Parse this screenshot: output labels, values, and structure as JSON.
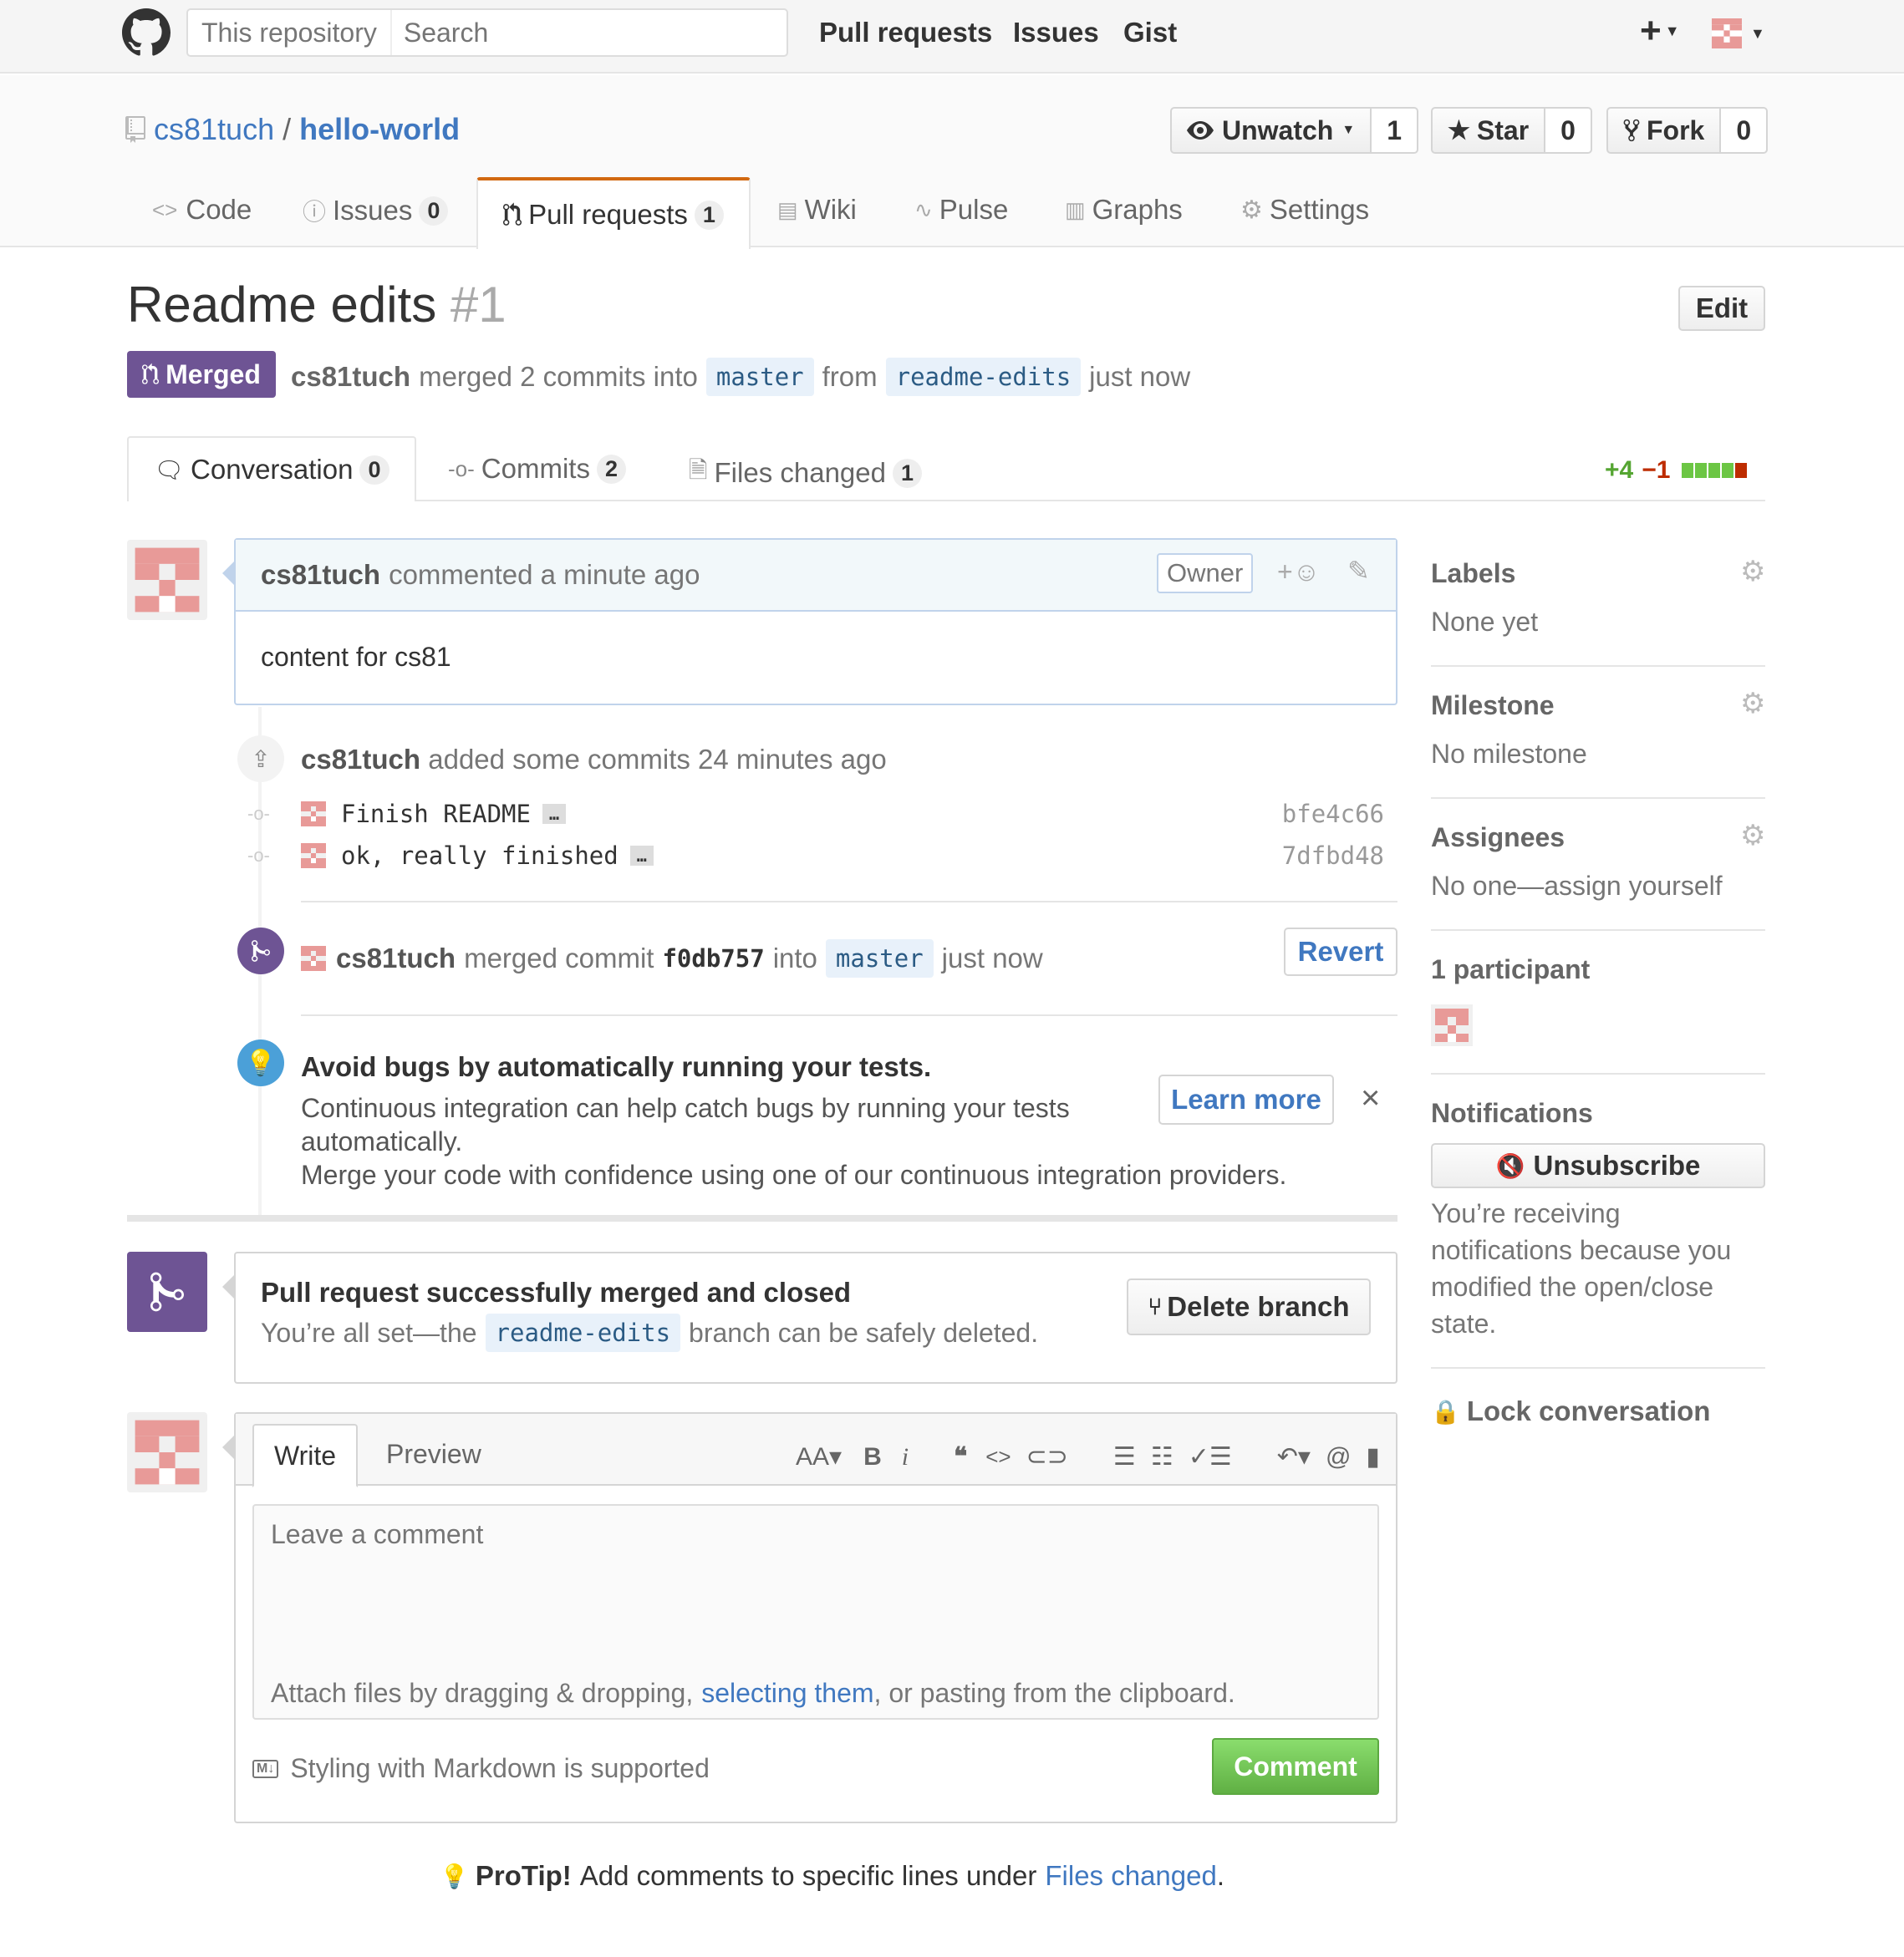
{
  "header": {
    "scope_label": "This repository",
    "search_placeholder": "Search",
    "nav": [
      "Pull requests",
      "Issues",
      "Gist"
    ],
    "plus_label": "+"
  },
  "repo": {
    "owner": "cs81tuch",
    "separator": "/",
    "name": "hello-world",
    "watch_label": "Unwatch",
    "watch_count": "1",
    "star_label": "Star",
    "star_count": "0",
    "fork_label": "Fork",
    "fork_count": "0"
  },
  "repo_tabs": [
    {
      "label": "Code",
      "count": "",
      "icon": "code-icon"
    },
    {
      "label": "Issues",
      "count": "0",
      "icon": "issue-icon"
    },
    {
      "label": "Pull requests",
      "count": "1",
      "icon": "pull-request-icon",
      "selected": true
    },
    {
      "label": "Wiki",
      "count": "",
      "icon": "book-icon"
    },
    {
      "label": "Pulse",
      "count": "",
      "icon": "pulse-icon"
    },
    {
      "label": "Graphs",
      "count": "",
      "icon": "graph-icon"
    },
    {
      "label": "Settings",
      "count": "",
      "icon": "gear-icon"
    }
  ],
  "pr": {
    "title": "Readme edits",
    "number": "#1",
    "edit_label": "Edit",
    "state": "Merged",
    "author": "cs81tuch",
    "merged_text": "merged 2 commits into",
    "base_branch": "master",
    "from_text": "from",
    "head_branch": "readme-edits",
    "time": "just now"
  },
  "pr_tabs": [
    {
      "label": "Conversation",
      "count": "0"
    },
    {
      "label": "Commits",
      "count": "2"
    },
    {
      "label": "Files changed",
      "count": "1"
    }
  ],
  "diffstat": {
    "additions": "+4",
    "deletions": "−1"
  },
  "comment": {
    "author": "cs81tuch",
    "meta": "commented a minute ago",
    "role": "Owner",
    "body": "content for cs81"
  },
  "commits_event": {
    "author": "cs81tuch",
    "text": "added some commits 24 minutes ago",
    "commits": [
      {
        "message": "Finish README",
        "sha": "bfe4c66"
      },
      {
        "message": "ok, really finished",
        "sha": "7dfbd48"
      }
    ],
    "ellipsis": "…"
  },
  "merge_event": {
    "author": "cs81tuch",
    "text": "merged commit",
    "sha": "f0db757",
    "into": "into",
    "branch": "master",
    "time": "just now",
    "revert_label": "Revert"
  },
  "ci_tip": {
    "title": "Avoid bugs by automatically running your tests.",
    "line1": "Continuous integration can help catch bugs by running your tests",
    "line2": "automatically.",
    "line3": "Merge your code with confidence using one of our continuous integration providers.",
    "learn_more": "Learn more"
  },
  "merged_box": {
    "title": "Pull request successfully merged and closed",
    "text_before": "You’re all set—the",
    "branch": "readme-edits",
    "text_after": "branch can be safely deleted.",
    "delete_label": "Delete branch"
  },
  "editor": {
    "write_tab": "Write",
    "preview_tab": "Preview",
    "placeholder": "Leave a comment",
    "attach_before": "Attach files by dragging & dropping,",
    "attach_link": "selecting them",
    "attach_after": ", or pasting from the clipboard.",
    "markdown_note": "Styling with Markdown is supported",
    "comment_label": "Comment",
    "toolbar": [
      "header-icon",
      "bold-icon",
      "italic-icon",
      "quote-icon",
      "code-icon",
      "link-icon",
      "unordered-list-icon",
      "ordered-list-icon",
      "task-list-icon",
      "reply-icon",
      "mention-icon",
      "bookmark-icon"
    ]
  },
  "protip": {
    "label": "ProTip!",
    "text": "Add comments to specific lines under",
    "link": "Files changed",
    "end": "."
  },
  "sidebar": {
    "labels_title": "Labels",
    "labels_value": "None yet",
    "milestone_title": "Milestone",
    "milestone_value": "No milestone",
    "assignees_title": "Assignees",
    "assignees_value": "No one—assign yourself",
    "participants_title": "1 participant",
    "notifications_title": "Notifications",
    "unsubscribe_label": "Unsubscribe",
    "notify_text": [
      "You’re receiving",
      "notifications because you",
      "modified the open/close",
      "state."
    ],
    "lock_label": "Lock conversation"
  },
  "colors": {
    "merged_purple": "#6e5494",
    "link_blue": "#4078c0",
    "green": "#55a532",
    "red": "#bd2c00",
    "orange_tab": "#d26911"
  }
}
